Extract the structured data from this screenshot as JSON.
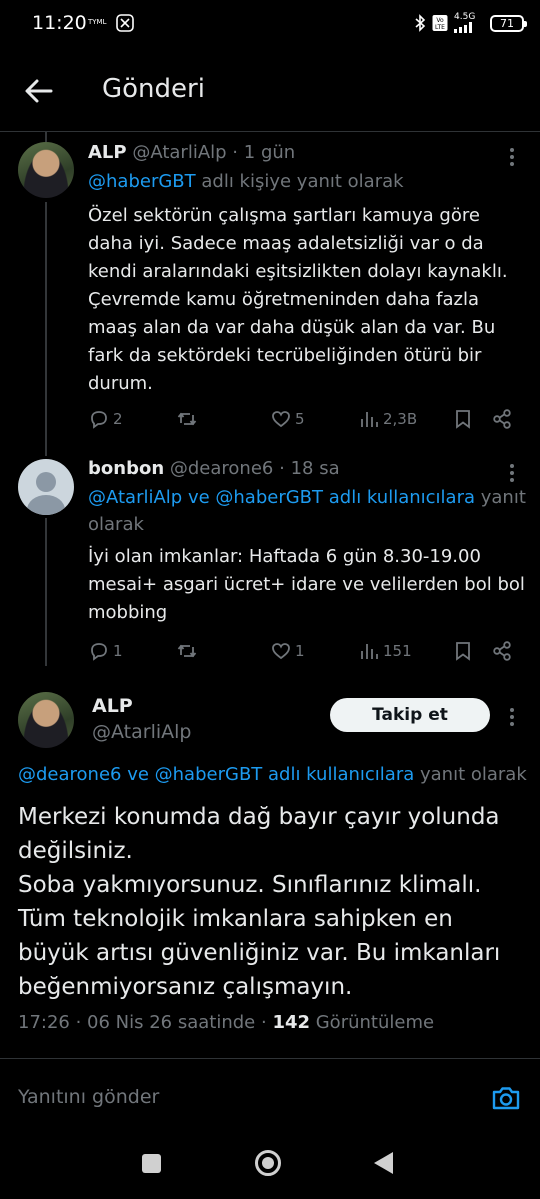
{
  "status_bar": {
    "time": "11:20",
    "carrier": "TYML",
    "network": "4.5G",
    "battery": "71"
  },
  "header": {
    "title": "Gönderi"
  },
  "tweets": [
    {
      "name": "ALP",
      "handle": "@AtarliAlp",
      "dot": "·",
      "time": "1 gün",
      "replying_mentions": "@haberGBT",
      "replying_suffix": " adlı kişiye yanıt olarak",
      "text": "Özel sektörün çalışma şartları kamuya göre daha iyi. Sadece maaş adaletsizliği var o da kendi aralarındaki eşitsizlikten dolayı kaynaklı. Çevremde kamu öğretmeninden daha fazla maaş alan da var daha düşük alan da var. Bu fark da sektördeki tecrübeliğinden ötürü bir durum.",
      "replies": "2",
      "retweets": "",
      "likes": "5",
      "views": "2,3B"
    },
    {
      "name": "bonbon",
      "handle": "@dearone6",
      "dot": "·",
      "time": "18 sa",
      "replying_mentions": "@AtarliAlp ve @haberGBT adlı kullanıcılara",
      "replying_suffix": " yanıt olarak",
      "text": "İyi olan imkanlar: Haftada 6 gün 8.30-19.00 mesai+ asgari ücret+ idare ve velilerden bol bol mobbing",
      "replies": "1",
      "retweets": "",
      "likes": "1",
      "views": "151"
    }
  ],
  "main_tweet": {
    "name": "ALP",
    "handle": "@AtarliAlp",
    "follow_label": "Takip et",
    "replying_mentions": "@dearone6 ve @haberGBT adlı kullanıcılara",
    "replying_suffix": " yanıt olarak",
    "text": "Merkezi konumda dağ bayır çayır yolunda değilsiniz.\nSoba yakmıyorsunuz. Sınıflarınız klimalı. Tüm teknolojik imkanlara sahipken en büyük artısı güvenliğiniz var. Bu imkanları beğenmiyorsanız çalışmayın.",
    "time": "17:26 · 06 Nis 26 saatinde · ",
    "views_count": "142",
    "views_label": " Görüntüleme"
  },
  "reply_box": {
    "placeholder": "Yanıtını gönder"
  },
  "colors": {
    "accent": "#1d9bf0",
    "background": "#000000",
    "muted": "#71767b",
    "text": "#e7e9ea"
  },
  "icons": [
    "back-arrow-icon",
    "more-icon",
    "reply-icon",
    "retweet-icon",
    "like-icon",
    "views-icon",
    "bookmark-icon",
    "share-icon",
    "camera-icon"
  ]
}
